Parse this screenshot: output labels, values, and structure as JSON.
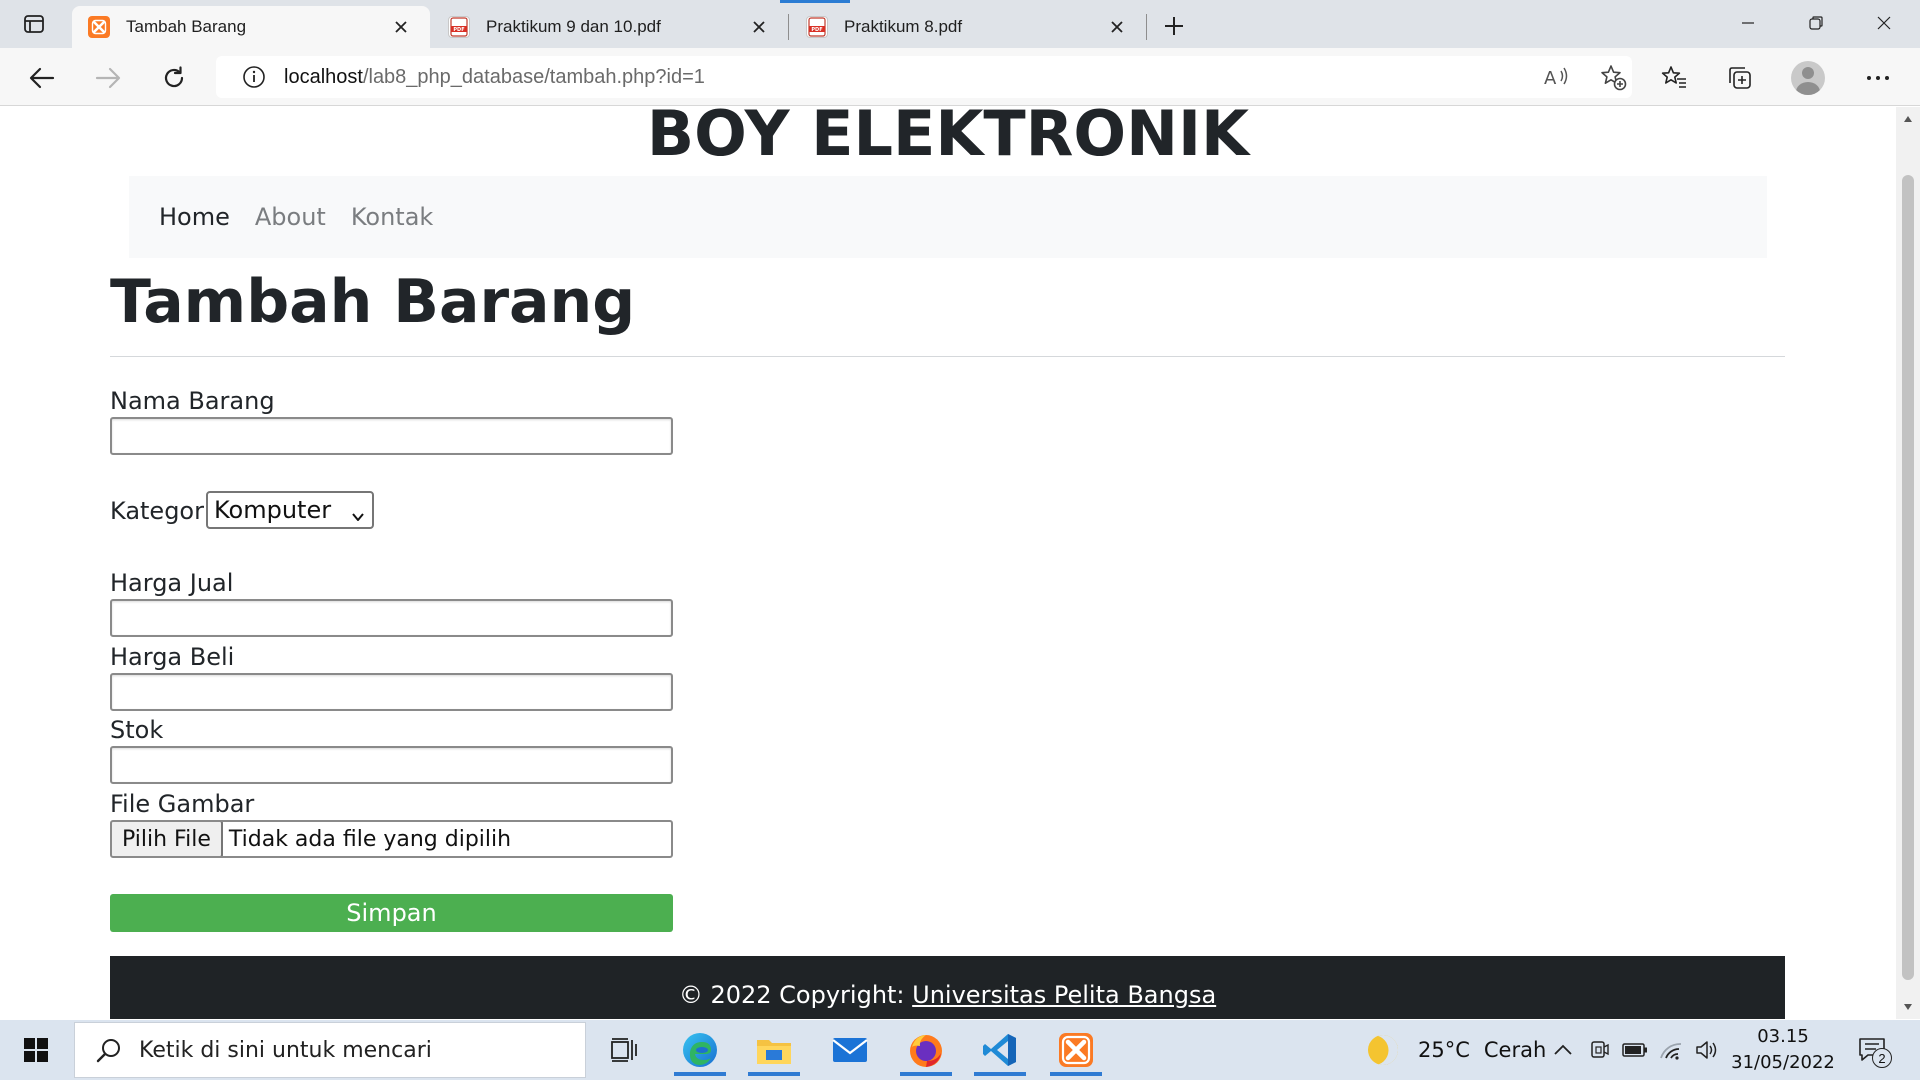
{
  "browser": {
    "tabs": [
      {
        "title": "Tambah Barang",
        "active": true,
        "favicon": "xampp-icon"
      },
      {
        "title": "Praktikum 9 dan 10.pdf",
        "active": false,
        "favicon": "pdf-icon"
      },
      {
        "title": "Praktikum 8.pdf",
        "active": false,
        "favicon": "pdf-icon"
      }
    ],
    "address": {
      "host": "localhost",
      "path": "/lab8_php_database/tambah.php?id=1"
    }
  },
  "site": {
    "title": "BOY ELEKTRONIK",
    "nav": [
      "Home",
      "About",
      "Kontak"
    ]
  },
  "page": {
    "heading": "Tambah Barang",
    "form": {
      "nama_label": "Nama Barang",
      "nama_value": "",
      "kategori_label": "Kategori",
      "kategori_selected": "Komputer",
      "harga_jual_label": "Harga Jual",
      "harga_jual_value": "",
      "harga_beli_label": "Harga Beli",
      "harga_beli_value": "",
      "stok_label": "Stok",
      "stok_value": "",
      "file_label": "File Gambar",
      "file_button": "Pilih File",
      "file_status": "Tidak ada file yang dipilih",
      "submit_label": "Simpan"
    },
    "footer": {
      "text": "© 2022 Copyright: ",
      "link": "Universitas Pelita Bangsa"
    }
  },
  "taskbar": {
    "search_placeholder": "Ketik di sini untuk mencari",
    "weather_temp": "25°C",
    "weather_desc": "Cerah",
    "time": "03.15",
    "date": "31/05/2022",
    "notification_count": "2"
  },
  "colors": {
    "submit": "#4caf50",
    "footer": "#1f2326",
    "xampp": "#fb7a24",
    "accent": "#2f7bd3"
  }
}
